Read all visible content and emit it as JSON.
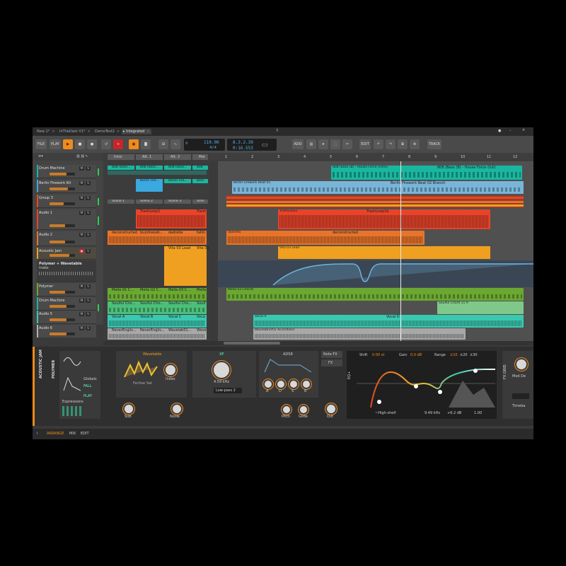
{
  "tabs": [
    {
      "label": "New 1*"
    },
    {
      "label": "InTheDark V1*"
    },
    {
      "label": "DemoTest2"
    },
    {
      "label": "Integrated"
    }
  ],
  "toolbar": {
    "file": "FILE",
    "play": "PLAY",
    "add": "ADD",
    "edit": "EDIT",
    "track": "TRACK",
    "tempo": "110.00",
    "time_signature": "4/4",
    "position_bars": "8.3.2.39",
    "position_time": "0:16.553"
  },
  "ruler": [
    "1",
    "2",
    "3",
    "4",
    "5",
    "6",
    "7",
    "8",
    "9",
    "10",
    "11",
    "12"
  ],
  "tracks": [
    {
      "name": "Drum Machine",
      "color": "#1ab7a0"
    },
    {
      "name": "Berlin Firework Kit",
      "color": "#3aa9e0"
    },
    {
      "name": "Group 3",
      "color": "#e84a1e"
    },
    {
      "name": "Audio 1",
      "color": "#e8442a"
    },
    {
      "name": "Audio 2",
      "color": "#e8742a"
    },
    {
      "name": "Acoustic Jam",
      "color": "#f0a020"
    },
    {
      "name": "Polymer + Wavetable",
      "sub": "Index"
    },
    {
      "name": "Polymer",
      "color": "#6aa832"
    },
    {
      "name": "Drum Machine",
      "color": "#1ab7a0"
    },
    {
      "name": "Audio 5",
      "color": "#3ac8b0"
    },
    {
      "name": "Audio 6",
      "color": "#b0b0b0"
    }
  ],
  "scenes": {
    "headers": [
      "Intro",
      "Alt. 1",
      "Alt. 2",
      "Mai"
    ],
    "rows": [
      [
        "808 (Bass...",
        "808 (Bass...",
        "808 (Bass...",
        "808"
      ],
      [
        "",
        "Berlin Fire...",
        "Berlin Fire...",
        "Berli"
      ],
      [
        "Scene 1",
        "Scene 2",
        "Scene 3",
        "Scen"
      ],
      [
        "",
        "TrashLoop1",
        "",
        "Trash"
      ],
      [
        "deconstructed",
        "buzzinessb...",
        "dadrella",
        "fallin"
      ],
      [
        "",
        "",
        "Vita 03 Lead",
        "Vita 03"
      ],
      [
        "",
        "",
        "",
        ""
      ],
      [
        "Mella 01 C...",
        "Mella 02 C...",
        "Mella 03 C...",
        "Mella"
      ],
      [
        "Soulful Cho...",
        "Soulful Cho...",
        "Soulful Cho...",
        "Soulf"
      ],
      [
        "Vocal A",
        "Vocal B",
        "Vocal C",
        "Voca"
      ],
      [
        "NeverEnglis...",
        "NeverEnglis...",
        "Wavelab01...",
        "Wave"
      ]
    ]
  },
  "arrange_clips": [
    {
      "label": "808 (Bass (B) - House Force (intro)",
      "label2": "808 (Bass (B) - House Force (full)"
    },
    {
      "label": "Berlin Firework Beat 01",
      "label2": "Berlin Firework Beat 02 Branch"
    },
    {
      "label": "TrashLoop1",
      "label2": "TrashLoop1b"
    },
    {
      "label": "dadrella",
      "label2": "deconstructed"
    },
    {
      "label": "Vita 03 Lead"
    },
    {
      "label": "Mella 03 Chords"
    },
    {
      "label": "Soulful Chord 11 A"
    },
    {
      "label": "Vocal A",
      "label2": "Vocal D"
    },
    {
      "label": "Wavelab1955 Accordions"
    }
  ],
  "device_panel": {
    "track_label": "ACOUSTIC JAM",
    "device_label": "POLYMER",
    "wavetable_title": "Wavetable",
    "wavetable_name": "Fartlue Sat",
    "index": "Index",
    "xp": "XP",
    "cutoff": "4.59 kHz",
    "filter": "Low-pass 2",
    "adsr": "ADSR",
    "adsr_knobs": [
      "A",
      "D",
      "S",
      "R"
    ],
    "globals": "Globals",
    "fall": "FALL",
    "play": "PLAY",
    "expressions": "Expressions",
    "sub": "Sub",
    "noise": "Noise",
    "pitch": "Pitch",
    "glide": "Glide",
    "out": "Out",
    "note_fx": "Note FX",
    "fx": "FX",
    "eq_label": "EQ+",
    "shift": "Shift",
    "shift_val": "0.00 st",
    "gain": "Gain",
    "gain_val": "0.0 dB",
    "range": "Range",
    "range_opts": [
      "±10",
      "±20",
      "±30"
    ],
    "band": "~High-shelf",
    "freq": "9.49 kHz",
    "band_gain": "+6.2 dB",
    "q": "1.00",
    "fx_grid": "FX GRID",
    "mod_label": "Mod De",
    "timebase": "Timeba"
  },
  "bottom": {
    "arrange": "ARRANGE",
    "mix": "MIX",
    "edit": "EDIT"
  },
  "colors": {
    "accent": "#f08a1a",
    "background": "#3a3a3a",
    "teal": "#1ab7a0",
    "red": "#e8442a",
    "orange": "#e8742a",
    "yellow": "#f0a020",
    "green": "#6aa832",
    "blue": "#3aa9e0"
  }
}
